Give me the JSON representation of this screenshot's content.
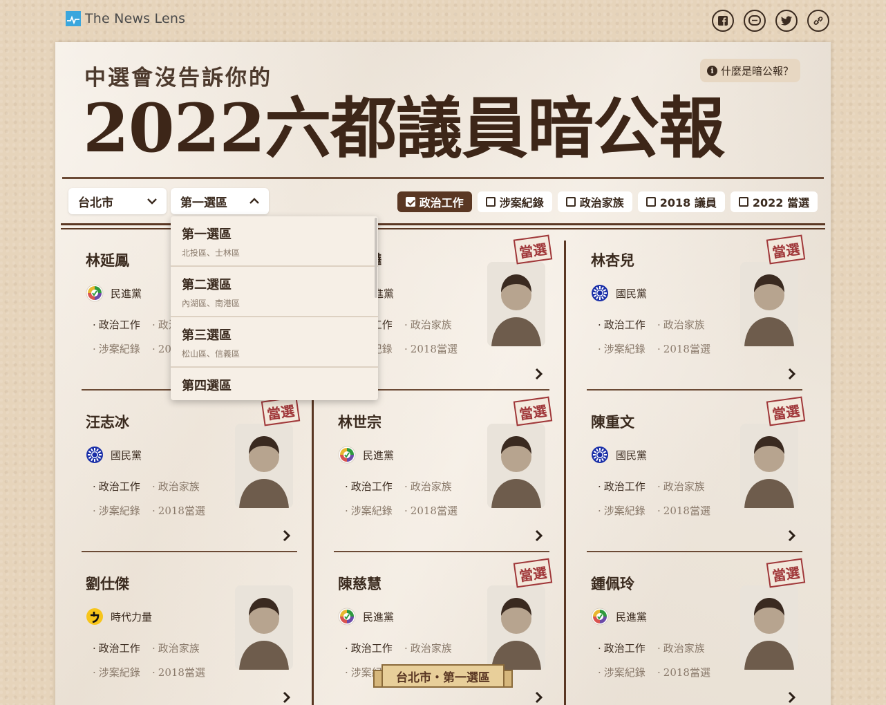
{
  "site": {
    "logo_text": "The News Lens"
  },
  "social": [
    {
      "name": "facebook-icon"
    },
    {
      "name": "line-icon"
    },
    {
      "name": "twitter-icon"
    },
    {
      "name": "link-icon"
    }
  ],
  "header": {
    "subtitle": "中選會沒告訴你的",
    "title": "2022六都議員暗公報",
    "help_label": "什麼是暗公報？"
  },
  "filters": {
    "city": "台北市",
    "district": "第一選區",
    "chips": [
      {
        "label": "政治工作",
        "checked": true
      },
      {
        "label": "涉案紀錄",
        "checked": false
      },
      {
        "label": "政治家族",
        "checked": false
      },
      {
        "label": "2018 議員",
        "checked": false
      },
      {
        "label": "2022 當選",
        "checked": false
      }
    ]
  },
  "dropdown": {
    "options": [
      {
        "title": "第一選區",
        "sub": "北投區、士林區"
      },
      {
        "title": "第二選區",
        "sub": "內湖區、南港區"
      },
      {
        "title": "第三選區",
        "sub": "松山區、信義區"
      },
      {
        "title": "第四選區",
        "sub": ""
      }
    ]
  },
  "stamp_label": "當選",
  "tag_labels": {
    "t1": "政治工作",
    "t2": "政治家族",
    "t3": "涉案紀錄",
    "t4": "2018當選"
  },
  "candidates": [
    {
      "name": "林延鳳",
      "party": "民進黨",
      "party_key": "dpp",
      "elected": false,
      "photo": false
    },
    {
      "name": "何孟樺",
      "party": "民進黨",
      "party_key": "dpp",
      "elected": true,
      "photo": true
    },
    {
      "name": "林杏兒",
      "party": "國民黨",
      "party_key": "kmt",
      "elected": true,
      "photo": true
    },
    {
      "name": "汪志冰",
      "party": "國民黨",
      "party_key": "kmt",
      "elected": true,
      "photo": true
    },
    {
      "name": "林世宗",
      "party": "民進黨",
      "party_key": "dpp",
      "elected": true,
      "photo": true
    },
    {
      "name": "陳重文",
      "party": "國民黨",
      "party_key": "kmt",
      "elected": true,
      "photo": true
    },
    {
      "name": "劉仕傑",
      "party": "時代力量",
      "party_key": "npp",
      "elected": false,
      "photo": true
    },
    {
      "name": "陳慈慧",
      "party": "民進黨",
      "party_key": "dpp",
      "elected": true,
      "photo": true
    },
    {
      "name": "鍾佩玲",
      "party": "民進黨",
      "party_key": "dpp",
      "elected": true,
      "photo": true
    }
  ],
  "ribbon_label": "台北市・第一選區",
  "colors": {
    "accent": "#5a3723",
    "stamp": "#a0383a",
    "paper": "#f3e9dc"
  }
}
